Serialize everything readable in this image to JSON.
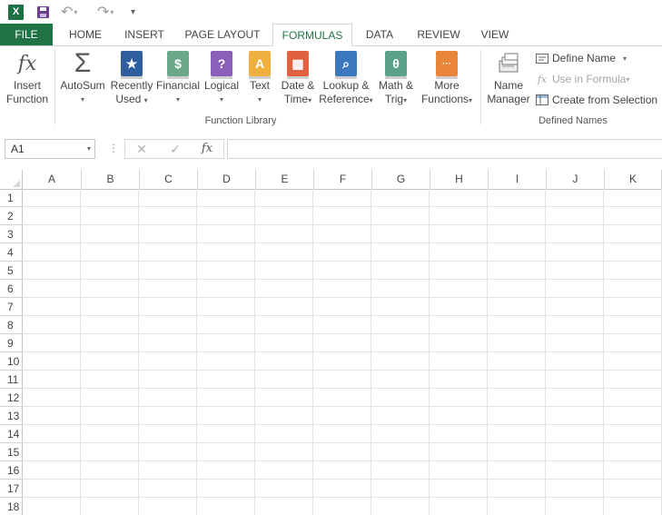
{
  "qat": {
    "app_icon": "excel-icon",
    "logo_text": "X",
    "save_icon": "save-icon",
    "undo_icon": "undo-icon",
    "redo_icon": "redo-icon",
    "customize_icon": "customize-qat-icon"
  },
  "tabs": [
    {
      "label": "FILE"
    },
    {
      "label": "HOME"
    },
    {
      "label": "INSERT"
    },
    {
      "label": "PAGE LAYOUT"
    },
    {
      "label": "FORMULAS"
    },
    {
      "label": "DATA"
    },
    {
      "label": "REVIEW"
    },
    {
      "label": "VIEW"
    }
  ],
  "active_tab": "FORMULAS",
  "ribbon": {
    "function_library": {
      "label": "Function Library",
      "insert_function": {
        "line1": "Insert",
        "line2": "Function",
        "glyph": "fx"
      },
      "autosum": {
        "line1": "AutoSum",
        "glyph": "Σ"
      },
      "recently_used": {
        "line1": "Recently",
        "line2": "Used",
        "glyph": "★"
      },
      "financial": {
        "line1": "Financial",
        "glyph": "$"
      },
      "logical": {
        "line1": "Logical",
        "glyph": "?"
      },
      "text": {
        "line1": "Text",
        "glyph": "A"
      },
      "date_time": {
        "line1": "Date &",
        "line2": "Time",
        "glyph": "▦"
      },
      "lookup_reference": {
        "line1": "Lookup &",
        "line2": "Reference",
        "glyph": "⌕"
      },
      "math_trig": {
        "line1": "Math &",
        "line2": "Trig",
        "glyph": "θ"
      },
      "more_functions": {
        "line1": "More",
        "line2": "Functions",
        "glyph": "···"
      }
    },
    "defined_names": {
      "label": "Defined Names",
      "name_manager": {
        "line1": "Name",
        "line2": "Manager"
      },
      "define_name": "Define Name",
      "use_in_formula": "Use in Formula",
      "create_from_selection": "Create from Selection"
    }
  },
  "formula_bar": {
    "name_box": "A1",
    "cancel_glyph": "✕",
    "enter_glyph": "✓",
    "fx_glyph": "fx",
    "formula": ""
  },
  "columns": [
    "A",
    "B",
    "C",
    "D",
    "E",
    "F",
    "G",
    "H",
    "I",
    "J",
    "K"
  ],
  "rows": [
    "1",
    "2",
    "3",
    "4",
    "5",
    "6",
    "7",
    "8",
    "9",
    "10",
    "11",
    "12",
    "13",
    "14",
    "15",
    "16",
    "17",
    "18"
  ],
  "colors": {
    "file_tab": "#217346",
    "active_tab_text": "#217346",
    "recently_used": "#2e5e9e",
    "financial": "#6aaa8a",
    "logical": "#8b5fb8",
    "text": "#f0b040",
    "date_time": "#e06040",
    "lookup_reference": "#3c78c0",
    "math_trig": "#5aa08a",
    "more_functions": "#e8853a"
  }
}
